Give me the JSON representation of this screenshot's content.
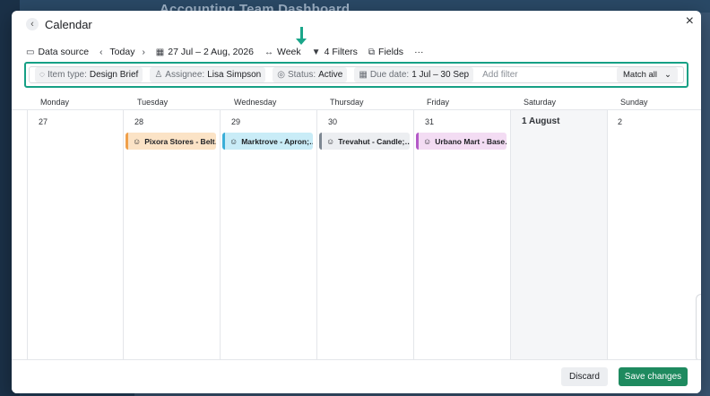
{
  "background": {
    "title": "Accounting Team Dashboard"
  },
  "modal": {
    "title": "Calendar",
    "back_icon": "chevron-left-icon",
    "close_icon": "close-icon"
  },
  "toolbar": {
    "data_source": "Data source",
    "today": "Today",
    "date_range": "27 Jul – 2 Aug, 2026",
    "view": "Week",
    "filters": "4 Filters",
    "fields": "Fields",
    "more": "···"
  },
  "filters": [
    {
      "key": "Item type:",
      "value": "Design Brief",
      "icon": "tag-icon"
    },
    {
      "key": "Assignee:",
      "value": "Lisa Simpson",
      "icon": "user-icon"
    },
    {
      "key": "Status:",
      "value": "Active",
      "icon": "status-icon"
    },
    {
      "key": "Due date:",
      "value": "1 Jul – 30 Sep",
      "icon": "calendar-icon"
    }
  ],
  "add_filter": "Add filter",
  "match_all": "Match all",
  "days": [
    "Monday",
    "Tuesday",
    "Wednesday",
    "Thursday",
    "Friday",
    "Saturday",
    "Sunday"
  ],
  "dates": [
    "27",
    "28",
    "29",
    "30",
    "31",
    "1 August",
    "2"
  ],
  "events": [
    {
      "label": "Pixora Stores - Belt…",
      "color": "#fbe3c6",
      "accent": "#f0a04b"
    },
    {
      "label": "Marktrove - Apron;…",
      "color": "#c9ecf7",
      "accent": "#3aaed8"
    },
    {
      "label": "Trevahut - Candle;…",
      "color": "#eceef1",
      "accent": "#7d8792"
    },
    {
      "label": "Urbano Mart - Base…",
      "color": "#f3dcf3",
      "accent": "#b45ac8"
    }
  ],
  "footer": {
    "discard": "Discard",
    "save": "Save changes"
  },
  "colors": {
    "highlight": "#16a085",
    "primary": "#1e8a5f"
  }
}
